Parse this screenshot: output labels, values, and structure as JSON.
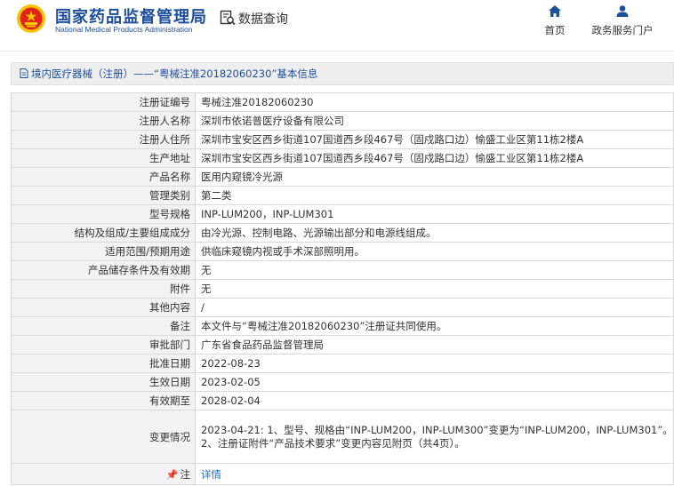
{
  "header": {
    "brand_cn": "国家药品监督管理局",
    "brand_en": "National Medical Products Administration",
    "data_query": "数据查询",
    "nav_home": "首页",
    "nav_gov_service": "政务服务门户",
    "brand_color": "#1d4f9c"
  },
  "breadcrumb": {
    "text": "境内医疗器械（注册）——“粤械注准20182060230”基本信息"
  },
  "record": {
    "rows": [
      {
        "label": "注册证编号",
        "value": "粤械注准20182060230"
      },
      {
        "label": "注册人名称",
        "value": "深圳市依诺普医疗设备有限公司"
      },
      {
        "label": "注册人住所",
        "value": "深圳市宝安区西乡街道107国道西乡段467号（固戍路口边）愉盛工业区第11栋2楼A"
      },
      {
        "label": "生产地址",
        "value": "深圳市宝安区西乡街道107国道西乡段467号（固戍路口边）愉盛工业区第11栋2楼A"
      },
      {
        "label": "产品名称",
        "value": "医用内窥镜冷光源"
      },
      {
        "label": "管理类别",
        "value": "第二类"
      },
      {
        "label": "型号规格",
        "value": "INP-LUM200，INP-LUM301"
      },
      {
        "label": "结构及组成/主要组成成分",
        "value": "由冷光源、控制电路、光源输出部分和电源线组成。"
      },
      {
        "label": "适用范围/预期用途",
        "value": "供临床窥镜内视或手术深部照明用。"
      },
      {
        "label": "产品储存条件及有效期",
        "value": "无"
      },
      {
        "label": "附件",
        "value": "无"
      },
      {
        "label": "其他内容",
        "value": "/"
      },
      {
        "label": "备注",
        "value": "本文件与“粤械注准20182060230”注册证共同使用。"
      },
      {
        "label": "审批部门",
        "value": "广东省食品药品监督管理局"
      },
      {
        "label": "批准日期",
        "value": "2022-08-23"
      },
      {
        "label": "生效日期",
        "value": "2023-02-05"
      },
      {
        "label": "有效期至",
        "value": "2028-02-04"
      }
    ],
    "change": {
      "label": "变更情况",
      "line1": "2023-04-21: 1、型号、规格由“INP-LUM200，INP-LUM300”变更为“INP-LUM200，INP-LUM301”。",
      "line2": "2、注册证附件“产品技术要求”变更内容见附页（共4页）。"
    },
    "note": {
      "label": "注",
      "icon": "pushpin-icon",
      "link": "详情"
    }
  }
}
